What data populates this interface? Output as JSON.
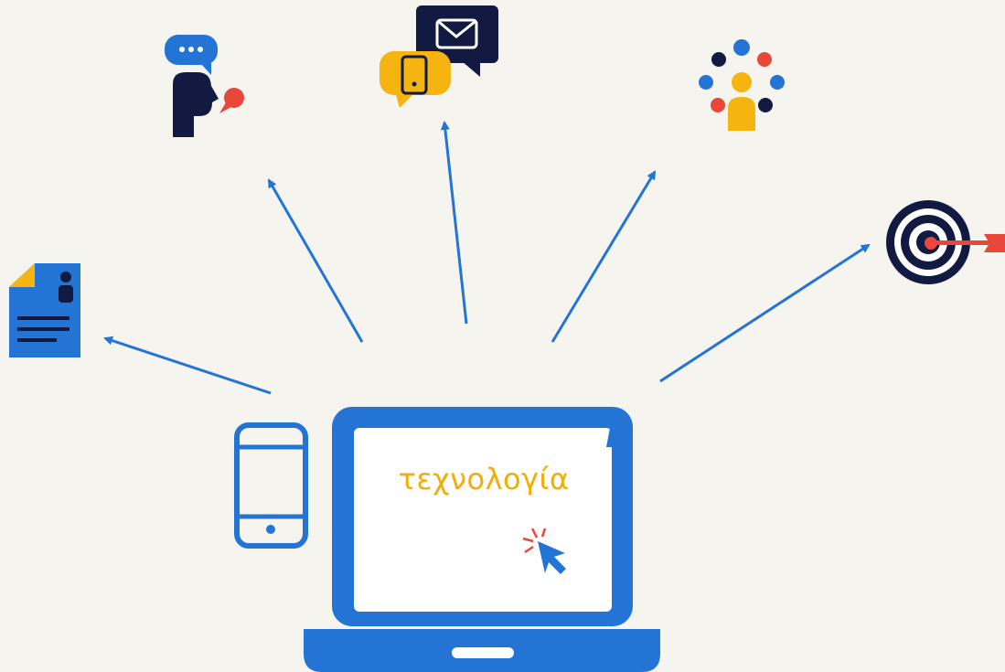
{
  "screen_label": "τεχνολογία",
  "colors": {
    "background": "#f5f4ef",
    "primary_blue": "#2374d4",
    "navy": "#121a42",
    "yellow": "#f5b40f",
    "red": "#e8473a",
    "white": "#ffffff"
  },
  "icons": [
    "document-profile-icon",
    "speaking-person-icon",
    "mobile-message-icon",
    "people-network-icon",
    "target-icon",
    "smartphone-icon",
    "laptop-icon",
    "cursor-click-icon"
  ]
}
